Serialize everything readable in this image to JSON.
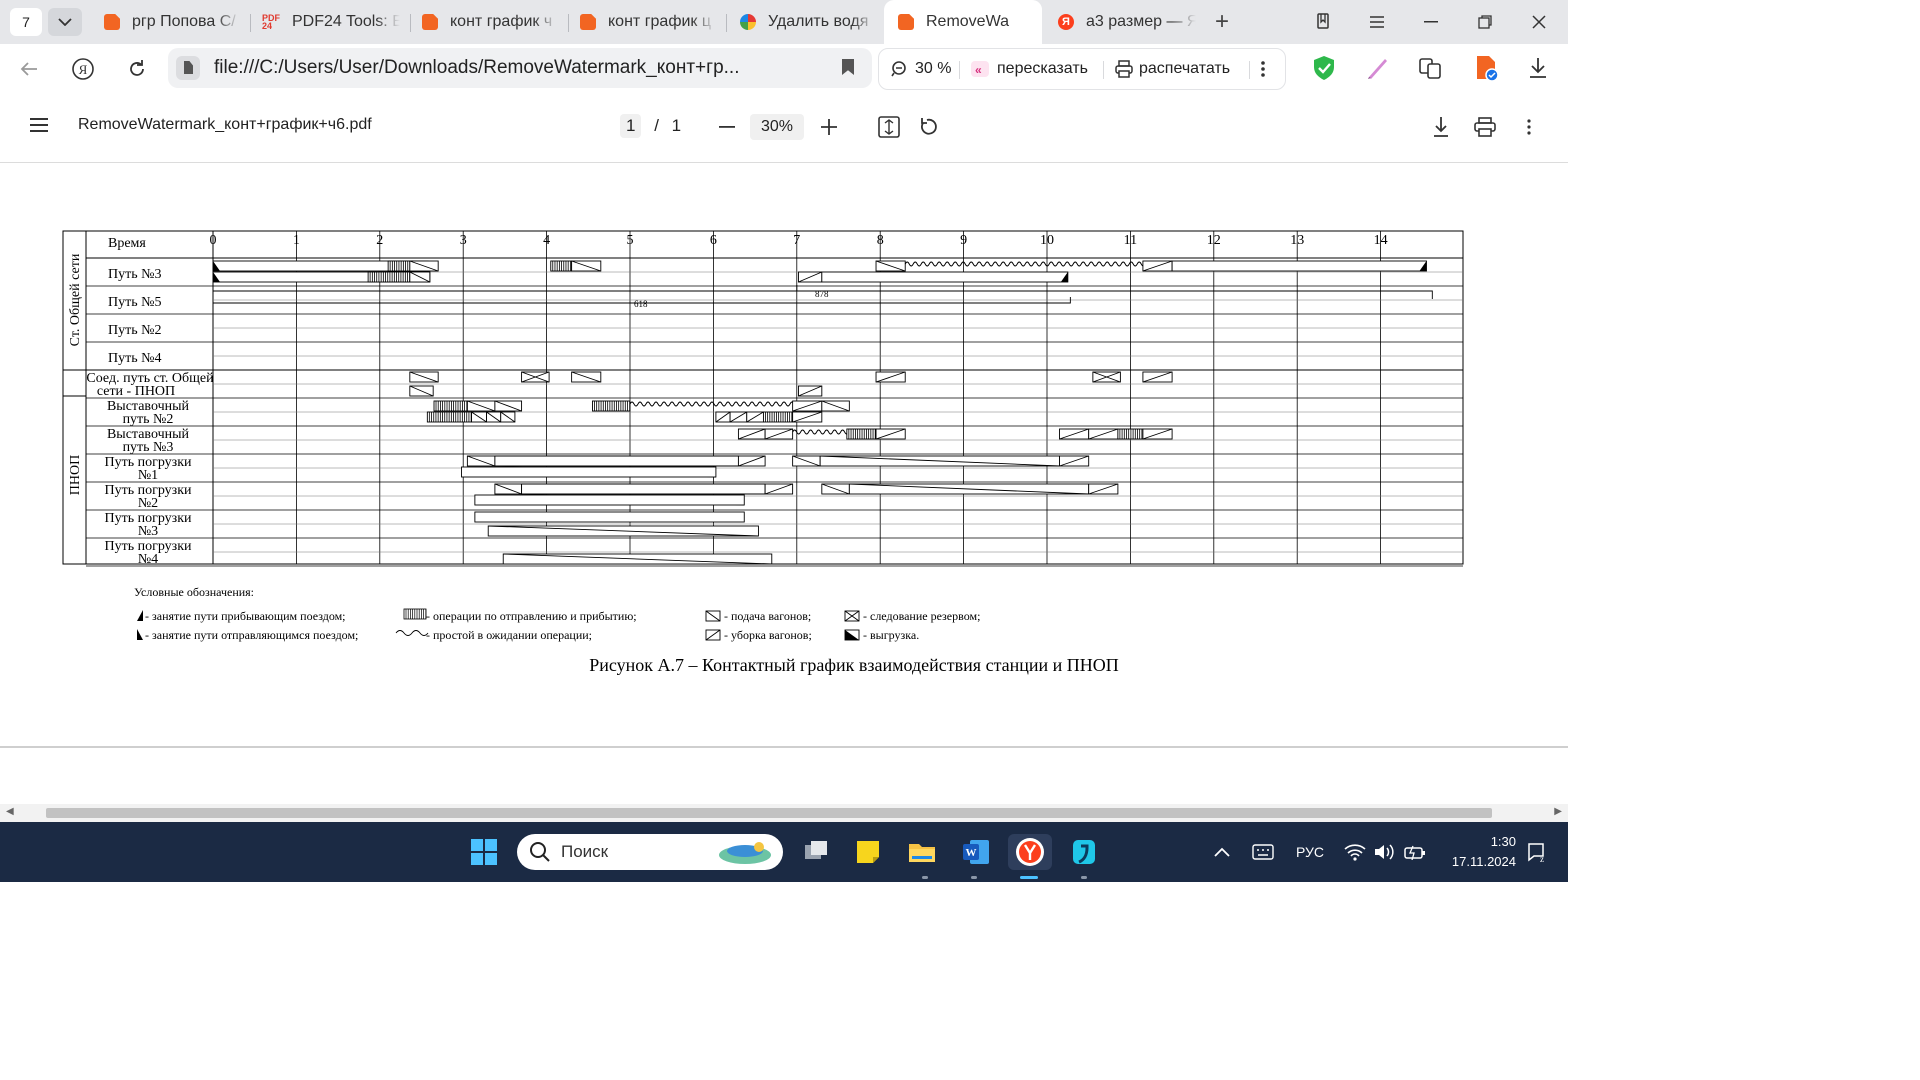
{
  "browser": {
    "tab_count": "7",
    "tabs": [
      {
        "label": "ргр Попова С/",
        "icon": "pdf-icon"
      },
      {
        "label": "PDF24 Tools: E",
        "icon": "pdf24-icon"
      },
      {
        "label": "конт график ч",
        "icon": "pdf-icon"
      },
      {
        "label": "конт график ц",
        "icon": "pdf-icon"
      },
      {
        "label": "Удалить водя",
        "icon": "google-icon"
      },
      {
        "label": "RemoveWa",
        "icon": "pdf-icon",
        "active": true
      },
      {
        "label": "а3 размер — Я",
        "icon": "yandex-icon"
      }
    ],
    "url": "file:///C:/Users/User/Downloads/RemoveWatermark_конт+гр...",
    "zoom_label": "30 %",
    "retell_label": "пересказать",
    "print_label": "распечатать"
  },
  "pdf": {
    "filename": "RemoveWatermark_конт+график+ч6.pdf",
    "current_page": "1",
    "page_separator": "/",
    "total_pages": "1",
    "zoom": "30%"
  },
  "chart_data": {
    "type": "gantt",
    "title": "Рисунок А.7 – Контактный график взаимодействия станции и ПНОП",
    "time_header": "Время",
    "time_ticks": [
      "0",
      "1",
      "2",
      "3",
      "4",
      "5",
      "6",
      "7",
      "8",
      "9",
      "10",
      "11",
      "12",
      "13",
      "14"
    ],
    "group_labels": [
      "Ст. Общей сети",
      "ПНОП"
    ],
    "rows": [
      {
        "label": "Путь №3"
      },
      {
        "label": "Путь №5"
      },
      {
        "label": "Путь №2"
      },
      {
        "label": "Путь №4"
      },
      {
        "label_lines": [
          "Соед. путь ст. Общей",
          "сети - ПНОП"
        ]
      },
      {
        "label_lines": [
          "Выставочный",
          "путь №2"
        ]
      },
      {
        "label_lines": [
          "Выставочный",
          "путь №3"
        ]
      },
      {
        "label_lines": [
          "Путь погрузки",
          "№1"
        ]
      },
      {
        "label_lines": [
          "Путь погрузки",
          "№2"
        ]
      },
      {
        "label_lines": [
          "Путь погрузки",
          "№3"
        ]
      },
      {
        "label_lines": [
          "Путь погрузки",
          "№4"
        ]
      }
    ],
    "train_labels": [
      "618",
      "878"
    ],
    "legend_title": "Условные обозначения:",
    "legend": [
      {
        "key": "arrival",
        "label": "- занятие пути прибывающим поездом;"
      },
      {
        "key": "ops",
        "label": "- операции по отправлению и прибытию;"
      },
      {
        "key": "supply",
        "label": "- подача вагонов;"
      },
      {
        "key": "reserve",
        "label": "- следование резервом;"
      },
      {
        "key": "departure",
        "label": "- занятие пути отправляющимся поездом;"
      },
      {
        "key": "idle",
        "label": "- простой в ожидании операции;"
      },
      {
        "key": "removal",
        "label": "- уборка вагонов;"
      },
      {
        "key": "unload",
        "label": "- выгрузка."
      }
    ]
  },
  "taskbar": {
    "search_label": "Поиск",
    "lang": "РУС",
    "time": "1:30",
    "date": "17.11.2024"
  }
}
